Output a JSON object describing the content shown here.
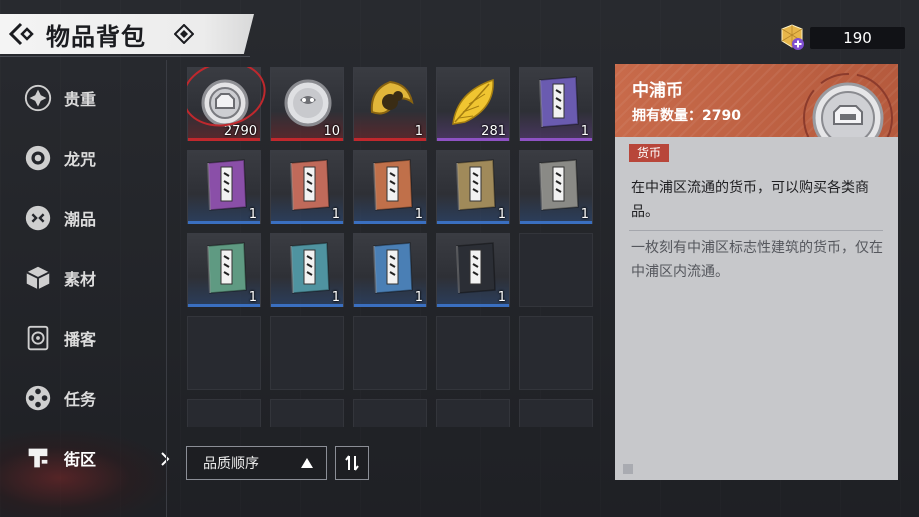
{
  "header": {
    "title": "物品背包"
  },
  "currency": {
    "amount": "190"
  },
  "sidebar": {
    "items": [
      {
        "label": "贵重",
        "icon": "diamond-star-icon"
      },
      {
        "label": "龙咒",
        "icon": "ring-icon"
      },
      {
        "label": "潮品",
        "icon": "mask-icon"
      },
      {
        "label": "素材",
        "icon": "cube-icon"
      },
      {
        "label": "播客",
        "icon": "speaker-icon"
      },
      {
        "label": "任务",
        "icon": "film-reel-icon"
      },
      {
        "label": "街区",
        "icon": "district-icon",
        "active": true
      }
    ]
  },
  "grid": {
    "items": [
      {
        "type": "coin",
        "count": "2790",
        "rarity": "#c0282d",
        "selected": true
      },
      {
        "type": "coin-face",
        "count": "10",
        "rarity": "#c0282d"
      },
      {
        "type": "gold-badge",
        "count": "1",
        "rarity": "#c0282d"
      },
      {
        "type": "gold-leaf",
        "count": "281",
        "rarity": "#8e52c4"
      },
      {
        "type": "book",
        "count": "1",
        "rarity": "#8e52c4",
        "color": "#6a5bb0"
      },
      {
        "type": "book",
        "count": "1",
        "rarity": "#3a6fc0",
        "color": "#8a4fa8"
      },
      {
        "type": "book",
        "count": "1",
        "rarity": "#3a6fc0",
        "color": "#c06a5a"
      },
      {
        "type": "book",
        "count": "1",
        "rarity": "#3a6fc0",
        "color": "#c0704a"
      },
      {
        "type": "book",
        "count": "1",
        "rarity": "#3a6fc0",
        "color": "#a08a5a"
      },
      {
        "type": "book",
        "count": "1",
        "rarity": "#3a6fc0",
        "color": "#8a8a86"
      },
      {
        "type": "book",
        "count": "1",
        "rarity": "#3a6fc0",
        "color": "#5f9a82"
      },
      {
        "type": "book",
        "count": "1",
        "rarity": "#3a6fc0",
        "color": "#4f93a0"
      },
      {
        "type": "book",
        "count": "1",
        "rarity": "#3a6fc0",
        "color": "#4a7fb5"
      },
      {
        "type": "book",
        "count": "1",
        "rarity": "#3a6fc0",
        "color": "#2b2e35"
      }
    ]
  },
  "sort": {
    "label": "品质顺序"
  },
  "detail": {
    "name": "中浦币",
    "owned": "拥有数量：2790",
    "tag": "货币",
    "description": "在中浦区流通的货币，可以购买各类商品。",
    "lore": "一枚刻有中浦区标志性建筑的货币，仅在中浦区内流通。"
  }
}
